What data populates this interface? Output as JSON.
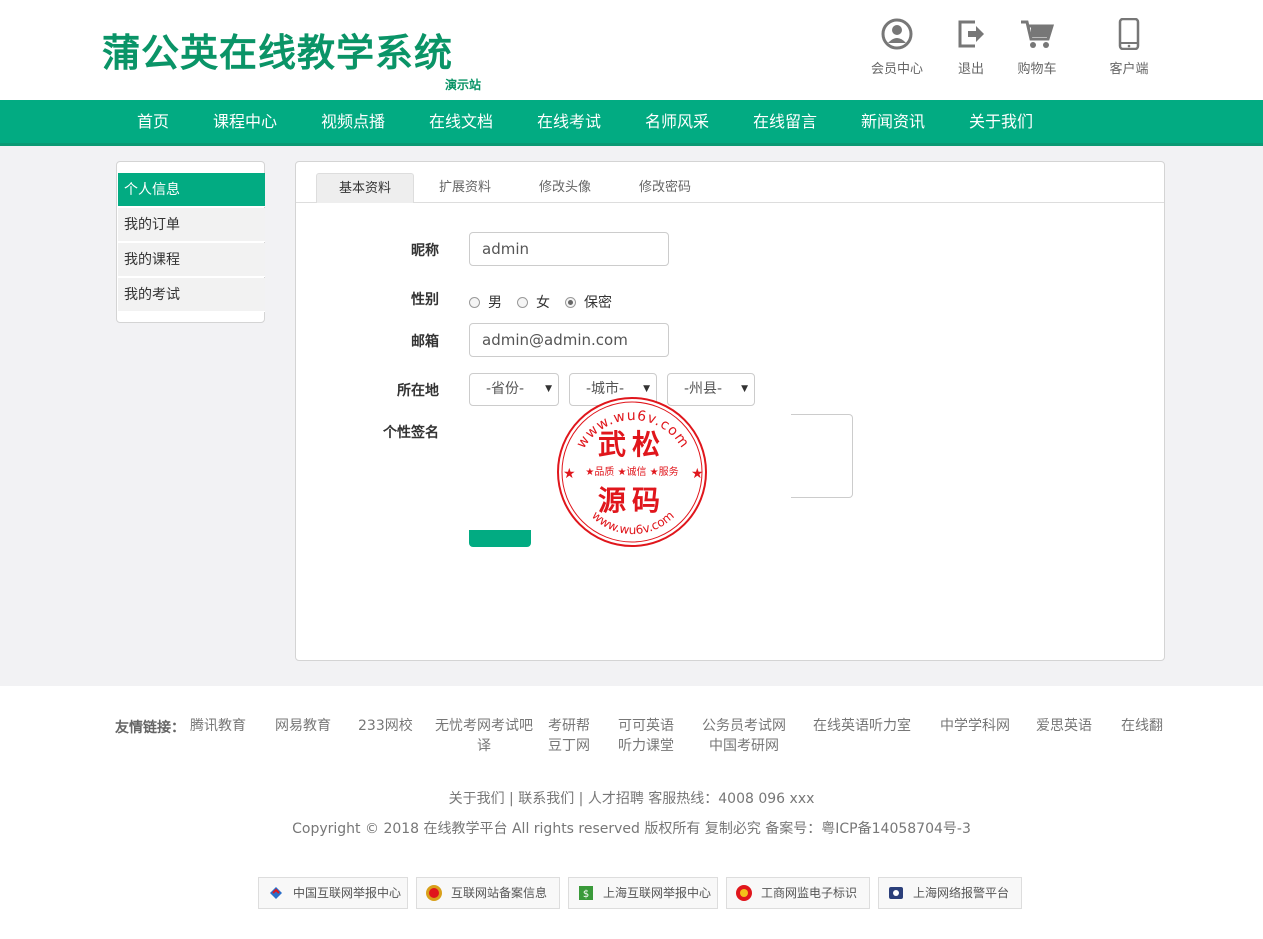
{
  "header": {
    "logo": "蒲公英在线教学系统",
    "logo_sub": "演示站",
    "icons": [
      {
        "icon": "user-circle-icon",
        "label": "会员中心"
      },
      {
        "icon": "logout-icon",
        "label": "退出"
      },
      {
        "icon": "cart-icon",
        "label": "购物车"
      },
      {
        "icon": "mobile-icon",
        "label": "客户端"
      }
    ]
  },
  "nav": [
    "首页",
    "课程中心",
    "视频点播",
    "在线文档",
    "在线考试",
    "名师风采",
    "在线留言",
    "新闻资讯",
    "关于我们"
  ],
  "sidebar": {
    "items": [
      "个人信息",
      "我的订单",
      "我的课程",
      "我的考试"
    ],
    "active": 0
  },
  "tabs": {
    "items": [
      "基本资料",
      "扩展资料",
      "修改头像",
      "修改密码"
    ],
    "active": 0
  },
  "form": {
    "nickname_label": "昵称",
    "nickname_value": "admin",
    "gender_label": "性别",
    "gender_options": [
      "男",
      "女",
      "保密"
    ],
    "gender_selected": "保密",
    "email_label": "邮箱",
    "email_value": "admin@admin.com",
    "location_label": "所在地",
    "province": "-省份-",
    "city": "-城市-",
    "county": "-州县-",
    "signature_label": "个性签名"
  },
  "watermark": {
    "top_text": "www.wu6v.com",
    "main_top": "武松",
    "middle": "★品质 ★诚信 ★服务",
    "main_bottom": "源码",
    "bottom_text": "www.wu6v.com"
  },
  "footer": {
    "links_title": "友情链接：",
    "links": [
      "腾讯教育",
      "网易教育",
      "233网校",
      "无忧考网考试吧译",
      "考研帮豆丁网",
      "可可英语听力课堂",
      "公务员考试网中国考研网",
      "在线英语听力室",
      "中学学科网",
      "爱思英语",
      "在线翻"
    ],
    "nav_line": "关于我们 | 联系我们 | 人才招聘  客服热线：4008 096 xxx",
    "copyright": "Copyright © 2018 在线教学平台 All rights reserved 版权所有 复制必究 备案号：粤ICP备14058704号-3",
    "badges": [
      "中国互联网举报中心",
      "互联网站备案信息",
      "上海互联网举报中心",
      "工商网监电子标识",
      "上海网络报警平台"
    ]
  },
  "colors": {
    "primary": "#02ab82",
    "logo": "#0a9467",
    "stamp": "#e0161c"
  }
}
